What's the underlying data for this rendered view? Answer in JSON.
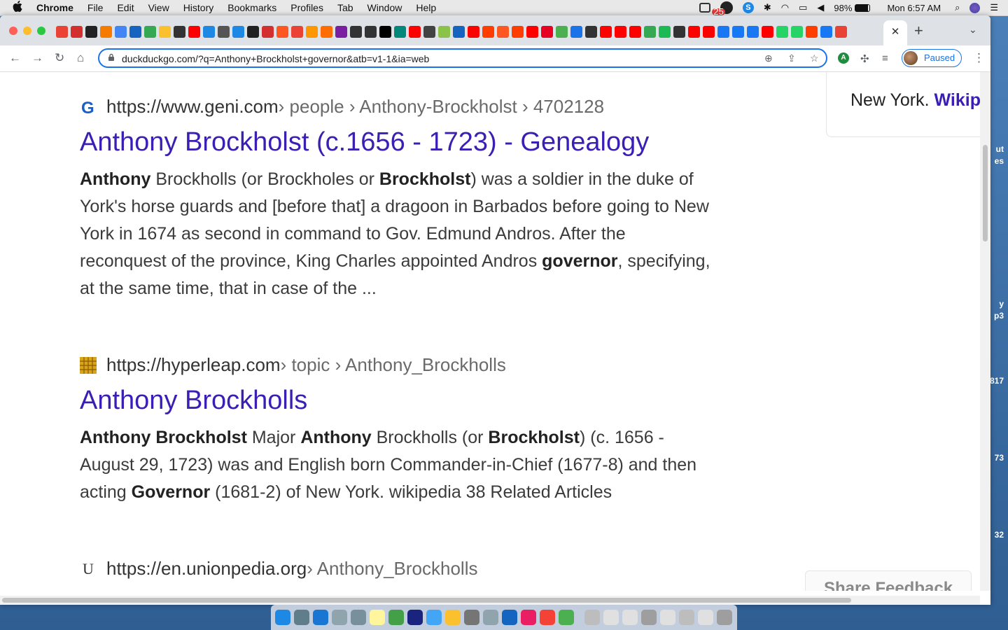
{
  "menubar": {
    "apple": "",
    "app": "Chrome",
    "items": [
      "File",
      "Edit",
      "View",
      "History",
      "Bookmarks",
      "Profiles",
      "Tab",
      "Window",
      "Help"
    ],
    "badge": "25",
    "battery": "98%",
    "clock": "Mon 6:57 AM"
  },
  "tabs": {
    "close": "✕",
    "new": "+",
    "dropdown": "⌄",
    "favicon_colors": [
      "#ea4335",
      "#d32f2f",
      "#222",
      "#f57c00",
      "#4285f4",
      "#1565c0",
      "#34a853",
      "#fbc02d",
      "#333",
      "#ff0000",
      "#1e88e5",
      "#555",
      "#1e88e5",
      "#212121",
      "#d32f2f",
      "#ff5722",
      "#ea4335",
      "#ff9800",
      "#ff6d00",
      "#7b1fa2",
      "#333",
      "#333",
      "#000",
      "#00897b",
      "#ff0000",
      "#424242",
      "#8bc34a",
      "#1565c0",
      "#ff0000",
      "#ff3d00",
      "#ff5722",
      "#ff3d00",
      "#ff0000",
      "#e60023",
      "#4caf50",
      "#1a73e8",
      "#333",
      "#ff0000",
      "#ff0000",
      "#ff0000",
      "#34a853",
      "#1db954",
      "#333",
      "#ff0000",
      "#ff0000",
      "#1877f2",
      "#1877f2",
      "#1877f2",
      "#ff0000",
      "#25d366",
      "#25d366",
      "#ff3d00",
      "#1877f2",
      "#ea4335"
    ]
  },
  "toolbar": {
    "back": "←",
    "forward": "→",
    "reload": "↻",
    "home": "⌂",
    "lock": "🔒",
    "url": "duckduckgo.com/?q=Anthony+Brockholst+governor&atb=v1-1&ia=web",
    "zoom": "⊕",
    "share": "⇪",
    "star": "☆",
    "ext_a": "A",
    "puzzle": "✣",
    "queue": "≡",
    "profile_label": "Paused",
    "menu": "⋮"
  },
  "sidebar": {
    "text": "New York.",
    "link": "Wikip"
  },
  "results": [
    {
      "favicon": "G",
      "domain": "https://www.geni.com",
      "path": " › people › Anthony-Brockholst › 4702128",
      "title": "Anthony Brockholst (c.1656 - 1723) - Genealogy",
      "snippet_parts": [
        {
          "b": "Anthony"
        },
        {
          "t": " Brockholls (or Brockholes or "
        },
        {
          "b": "Brockholst"
        },
        {
          "t": ") was a soldier in the duke of York's horse guards and [before that] a dragoon in Barbados before going to New York in 1674 as second in command to Gov. Edmund Andros. After the reconquest of the province, King Charles appointed Andros "
        },
        {
          "b": "governor"
        },
        {
          "t": ", specifying, at the same time, that in case of the ..."
        }
      ]
    },
    {
      "favicon": "",
      "domain": "https://hyperleap.com",
      "path": " › topic › Anthony_Brockholls",
      "title": "Anthony Brockholls",
      "snippet_parts": [
        {
          "b": "Anthony Brockholst"
        },
        {
          "t": " Major "
        },
        {
          "b": "Anthony"
        },
        {
          "t": " Brockholls (or "
        },
        {
          "b": "Brockholst"
        },
        {
          "t": ") (c. 1656 - August 29, 1723) was and English born Commander-in-Chief (1677-8) and then acting "
        },
        {
          "b": "Governor"
        },
        {
          "t": " (1681-2) of New York. wikipedia 38 Related Articles"
        }
      ]
    },
    {
      "favicon": "U",
      "domain": "https://en.unionpedia.org",
      "path": " › Anthony_Brockholls"
    }
  ],
  "feedback": "Share Feedback",
  "wallpaper_fragments": [
    "ut",
    "es",
    "y",
    "p3",
    "817",
    "73",
    "32"
  ],
  "dock": {
    "icon_colors": [
      "#1e88e5",
      "#607d8b",
      "#1976d2",
      "#90a4ae",
      "#78909c",
      "#fff59d",
      "#43a047",
      "#1a237e",
      "#42a5f5",
      "#fbc02d",
      "#757575",
      "#90a4ae",
      "#1565c0",
      "#e91e63",
      "#f44336",
      "#4caf50",
      "#bdbdbd",
      "#e0e0e0",
      "#e0e0e0",
      "#9e9e9e",
      "#e0e0e0",
      "#bdbdbd",
      "#e0e0e0",
      "#9e9e9e"
    ]
  }
}
